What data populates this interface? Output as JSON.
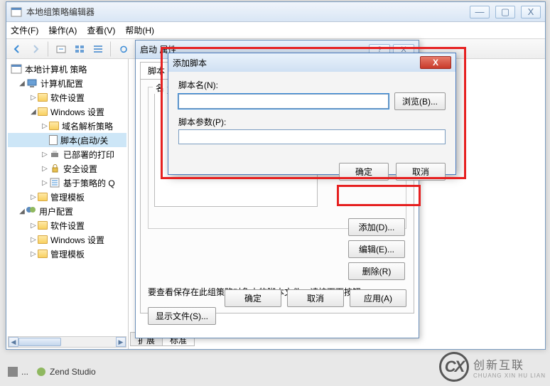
{
  "window": {
    "title": "本地组策略编辑器",
    "min": "—",
    "max": "▢",
    "close": "X"
  },
  "menu": {
    "file": "文件(F)",
    "action": "操作(A)",
    "view": "查看(V)",
    "help": "帮助(H)"
  },
  "tree": {
    "root": "本地计算机 策略",
    "computer": "计算机配置",
    "software": "软件设置",
    "windows": "Windows 设置",
    "dns": "域名解析策略",
    "scripts": "脚本(启动/关",
    "printers": "已部署的打印",
    "security": "安全设置",
    "policy_based": "基于策略的 Q",
    "templates": "管理模板",
    "user": "用户配置",
    "u_software": "软件设置",
    "u_windows": "Windows 设置",
    "u_templates": "管理模板"
  },
  "tabs": {
    "extended": "扩展",
    "standard": "标准"
  },
  "prop": {
    "title": "启动 属性",
    "tab_script": "脚本",
    "group_label": "名",
    "add": "添加(D)...",
    "edit": "编辑(E)...",
    "remove": "删除(R)",
    "hint": "要查看保存在此组策略对象中的脚本文件，请按下面按钮。",
    "showfiles": "显示文件(S)...",
    "ok": "确定",
    "cancel": "取消",
    "apply": "应用(A)",
    "help_q": "?",
    "help_x": "X"
  },
  "add": {
    "title": "添加脚本",
    "name_label": "脚本名(N):",
    "name_value": "",
    "param_label": "脚本参数(P):",
    "param_value": "",
    "browse": "浏览(B)...",
    "ok": "确定",
    "cancel": "取消"
  },
  "taskbar": {
    "item2": "Zend Studio"
  },
  "watermark": {
    "logo": "CX",
    "text": "创新互联",
    "sub": "CHUANG XIN HU LIAN"
  }
}
